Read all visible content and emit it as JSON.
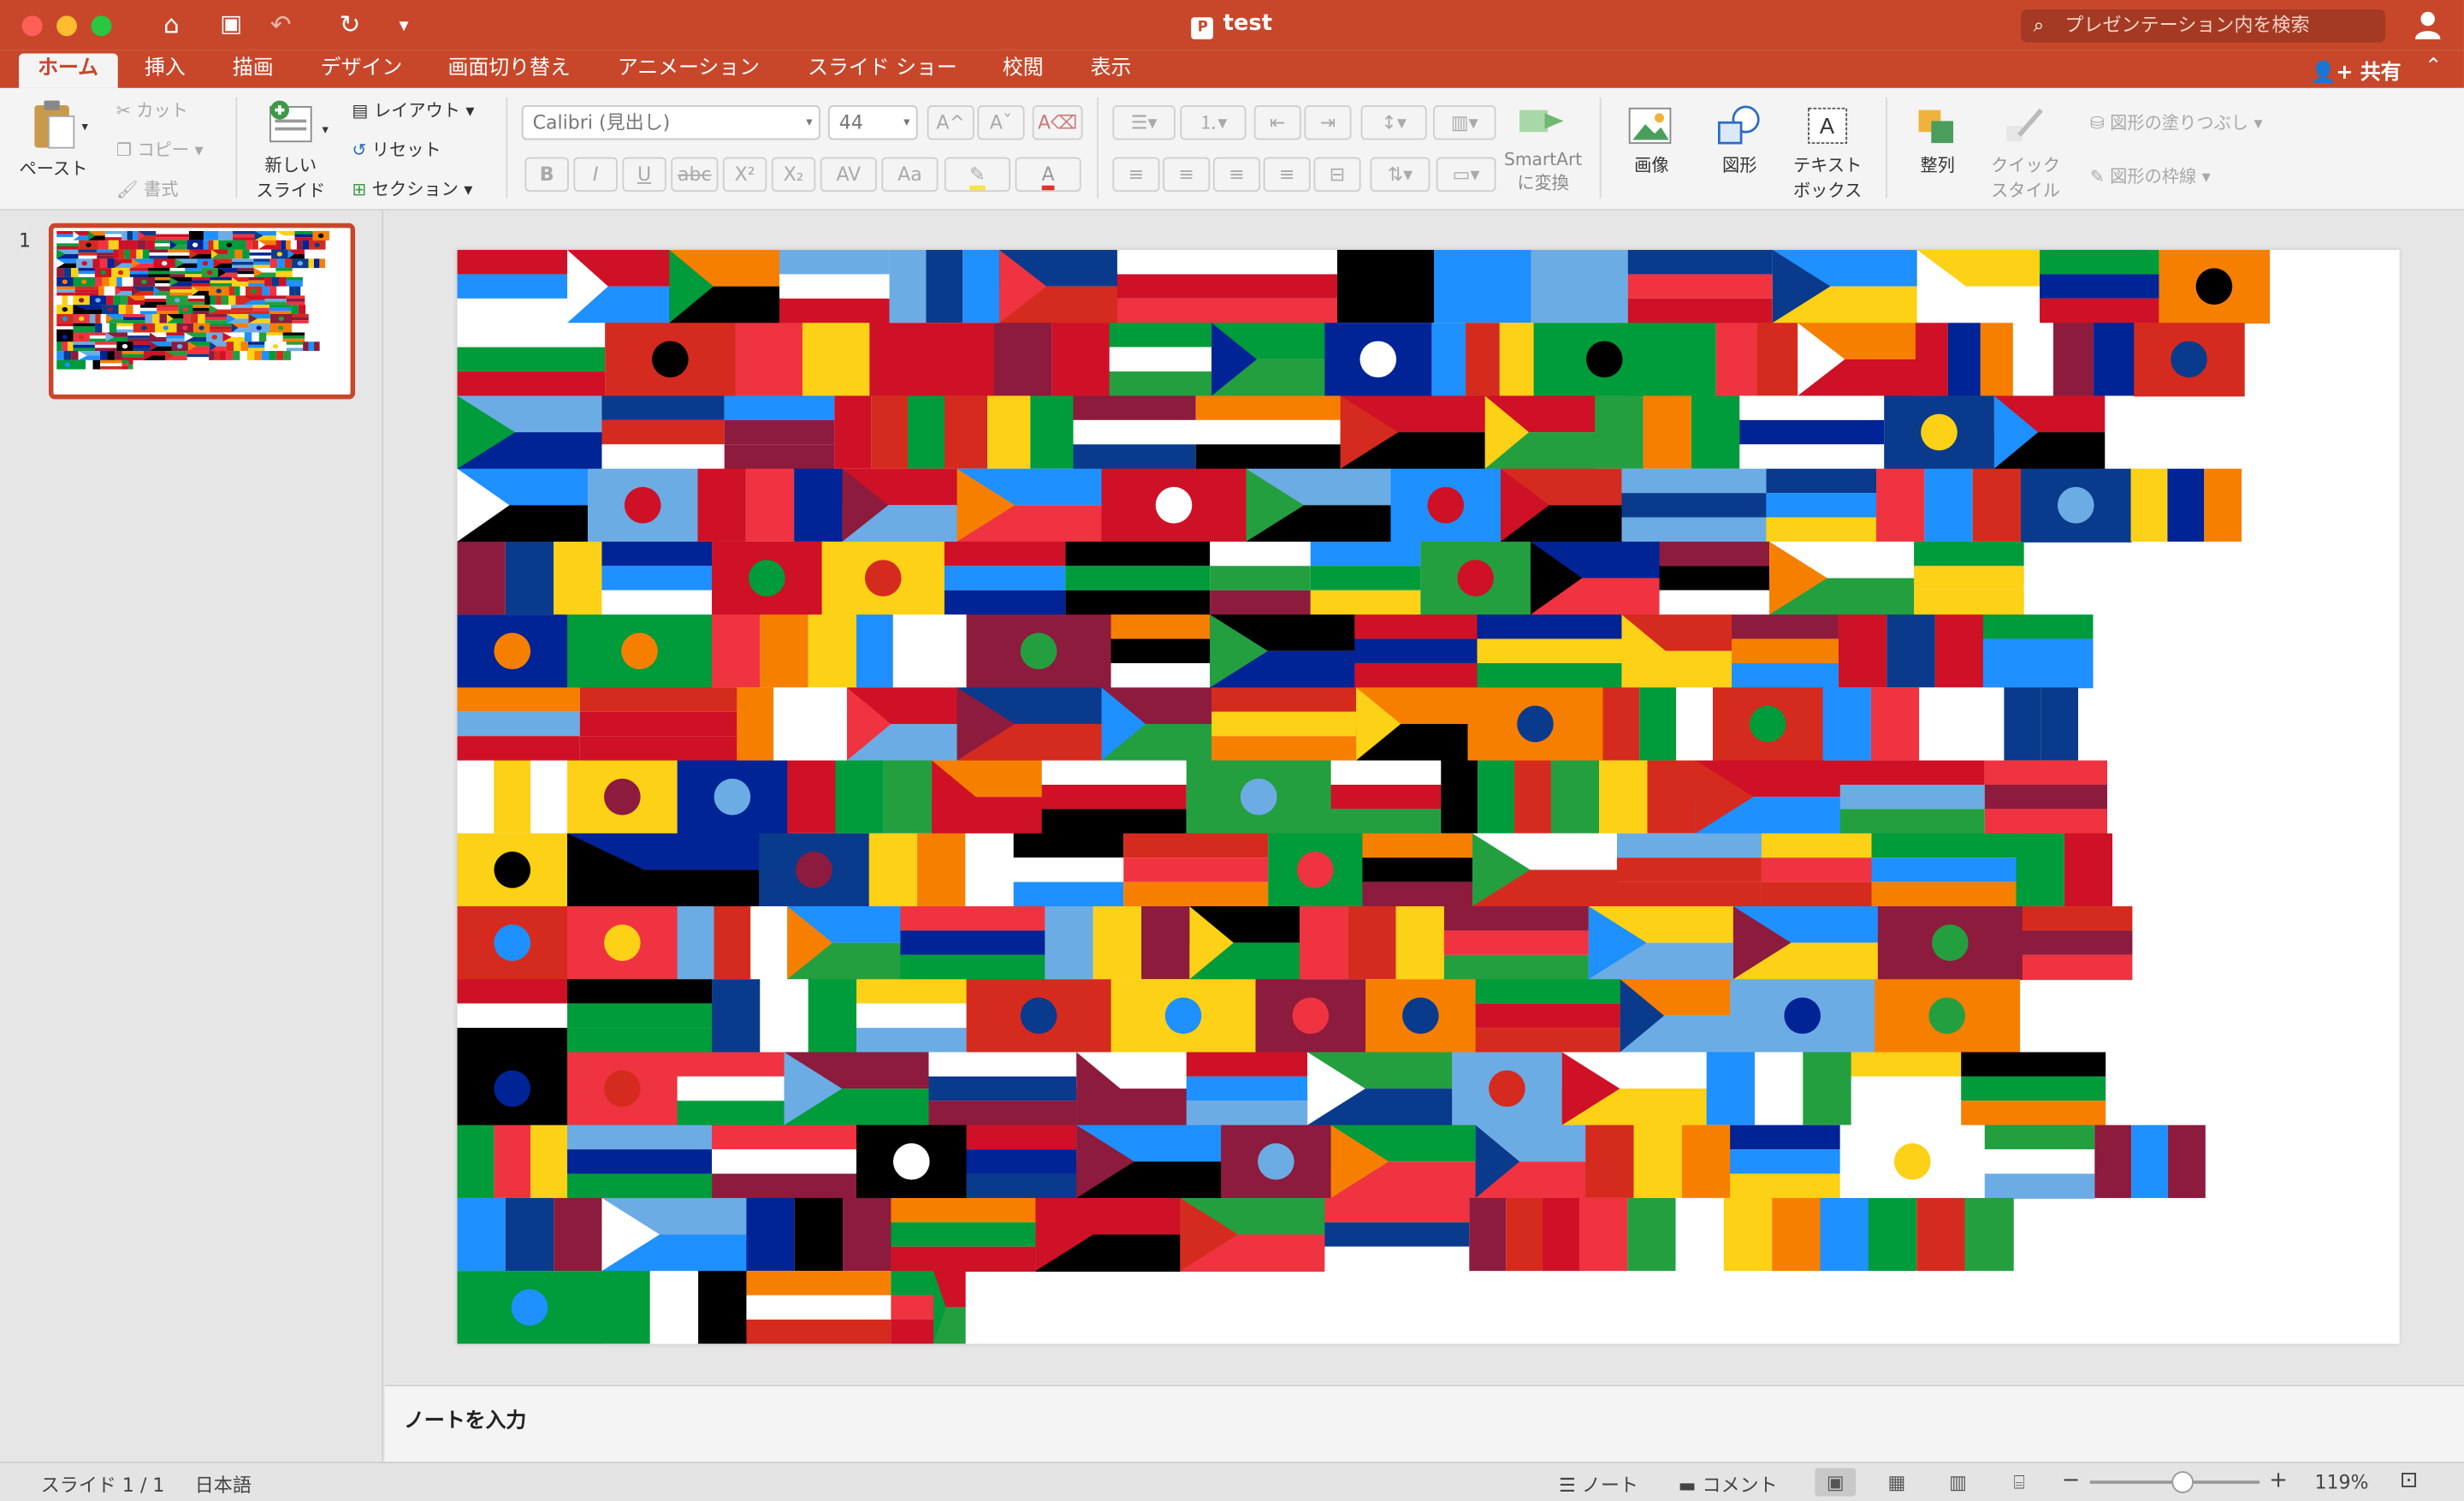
{
  "window": {
    "title": "test"
  },
  "search": {
    "placeholder": "プレゼンテーション内を検索"
  },
  "tabs": [
    "ホーム",
    "挿入",
    "描画",
    "デザイン",
    "画面切り替え",
    "アニメーション",
    "スライド ショー",
    "校閲",
    "表示"
  ],
  "share_label": "共有",
  "ribbon": {
    "paste": "ペースト",
    "cut": "カット",
    "copy": "コピー",
    "format": "書式",
    "new_slide_1": "新しい",
    "new_slide_2": "スライド",
    "layout": "レイアウト",
    "reset": "リセット",
    "section": "セクション",
    "font_name": "Calibri (見出し)",
    "font_size": "44",
    "smartart_1": "SmartArt",
    "smartart_2": "に変換",
    "picture": "画像",
    "shapes": "図形",
    "textbox_1": "テキスト",
    "textbox_2": "ボックス",
    "arrange": "整列",
    "quick_style_1": "クイック",
    "quick_style_2": "スタイル",
    "shape_fill": "図形の塗りつぶし",
    "shape_outline": "図形の枠線"
  },
  "thumbnail": {
    "number": "1"
  },
  "notes": {
    "placeholder": "ノートを入力"
  },
  "status": {
    "slide_info": "スライド 1 / 1",
    "language": "日本語",
    "notes_btn": "ノート",
    "comments_btn": "コメント",
    "zoom_minus": "−",
    "zoom_plus": "+",
    "zoom": "119%",
    "zoom_fraction": 0.55
  },
  "colors": {
    "accent": "#c8472b"
  }
}
